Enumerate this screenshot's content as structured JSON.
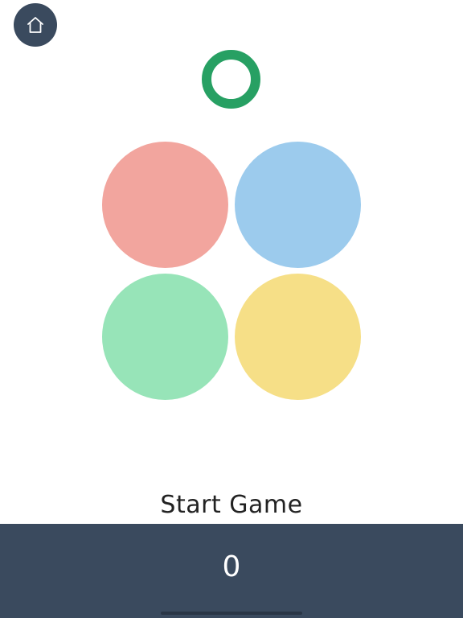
{
  "header": {
    "home_icon": "home-icon"
  },
  "indicator": {
    "icon": "ring-icon",
    "color": "#27a063"
  },
  "pads": [
    {
      "id": "red",
      "color": "#f2a59e"
    },
    {
      "id": "blue",
      "color": "#9ccbed"
    },
    {
      "id": "green",
      "color": "#97e4b8"
    },
    {
      "id": "yellow",
      "color": "#f6df87"
    }
  ],
  "controls": {
    "start_label": "Start Game"
  },
  "score": {
    "value": "0",
    "bar_color": "#3a4a5e"
  }
}
